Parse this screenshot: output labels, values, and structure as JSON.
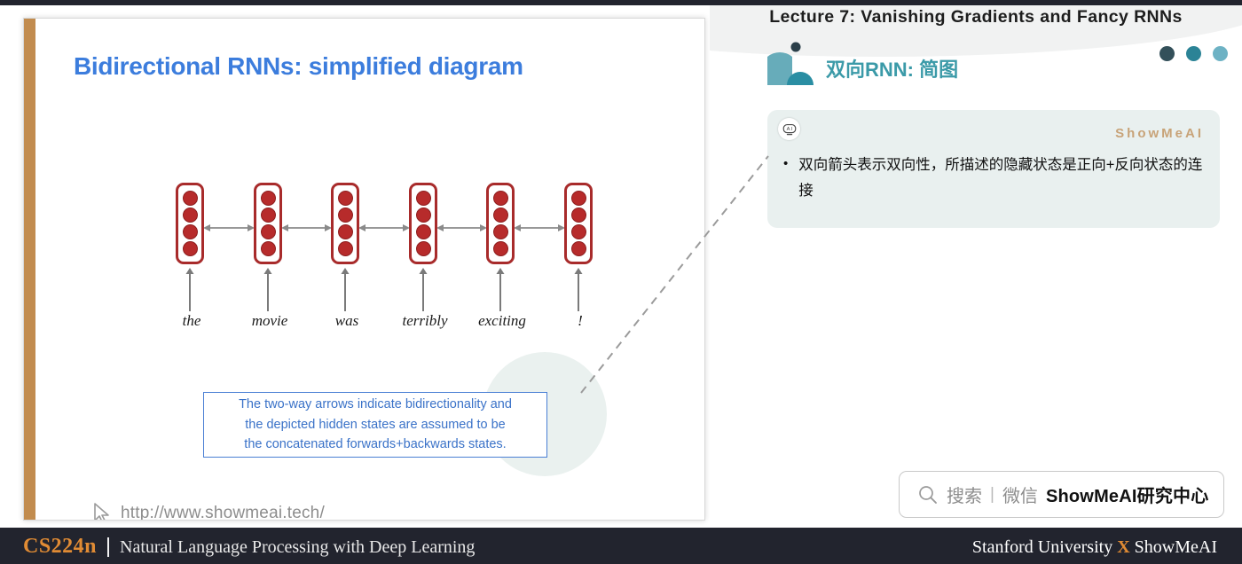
{
  "window": {
    "top_strip_color": "#22242e"
  },
  "slide": {
    "title": "Bidirectional RNNs: simplified diagram",
    "accent_color": "#c28c4f",
    "title_color": "#3c7ddd",
    "diagram": {
      "type": "bidirectional-rnn",
      "cell_border_color": "#a82b2b",
      "node_color": "#b72b2b",
      "nodes_per_cell": 4,
      "tokens": [
        "the",
        "movie",
        "was",
        "terribly",
        "exciting",
        "!"
      ],
      "bidirectional_arrows": 5
    },
    "callout": {
      "line1": "The two-way arrows indicate bidirectionality and",
      "line2": "the depicted hidden states are assumed to be",
      "line3": "the concatenated forwards+backwards states.",
      "border_color": "#4a7fd4",
      "text_color": "#3a72c8"
    },
    "watermark": {
      "icon": "cursor-icon",
      "url": "http://www.showmeai.tech/"
    }
  },
  "right_panel": {
    "lecture_title": "Lecture 7: Vanishing Gradients and Fancy RNNs",
    "section_title": "双向RNN: 简图",
    "section_title_color": "#3b9aa8",
    "brand_icon": "showmeai-logo-icon",
    "header_dots": [
      "#33505a",
      "#2b8396",
      "#6db2c4"
    ],
    "card": {
      "ai_icon": "ai-robot-icon",
      "brand": "ShowMeAI",
      "brand_color": "#c8a378",
      "bullet_marker": "•",
      "bullet_text": "双向箭头表示双向性，所描述的隐藏状态是正向+反向状态的连接",
      "background": "#e9f0ef"
    },
    "search_pill": {
      "icon": "search-icon",
      "placeholder": "搜索",
      "separator": "|",
      "channel_label": "微信",
      "brand": "ShowMeAI研究中心"
    }
  },
  "footer": {
    "course_code": "CS224n",
    "divider": "|",
    "course_name": "Natural Language Processing with Deep Learning",
    "right_prefix": "Stanford University ",
    "right_x": "X",
    "right_suffix": " ShowMeAI",
    "background": "#22242e",
    "accent_color": "#e08b34"
  }
}
